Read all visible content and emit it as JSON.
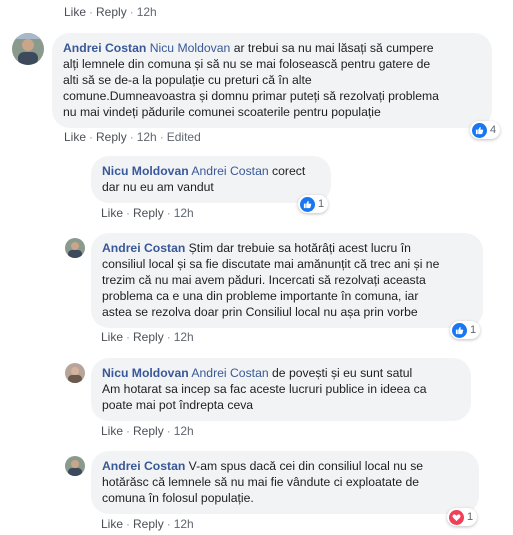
{
  "actions": {
    "like": "Like",
    "reply": "Reply",
    "sep": "·"
  },
  "top": {
    "time": "12h"
  },
  "comments": [
    {
      "author": "Andrei Costan",
      "mention": "Nicu Moldovan",
      "lines": [
        " ar trebui sa nu mai lăsați să cumpere",
        "alți lemnele din comuna și să nu se mai folosească pentru gatere de",
        "alti să se de-a la populație cu preturi că în alte",
        "comune.Dumneavoastra și domnu primar puteți să rezolvați problema",
        "nu mai vindeți pădurile comunei scoaterile pentru populație"
      ],
      "time": "12h",
      "edited": "Edited",
      "reactions": {
        "type": "like",
        "count": "4"
      }
    },
    {
      "author": "Nicu Moldovan",
      "mention": "Andrei Costan",
      "lines": [
        " corect",
        "dar nu eu am vandut"
      ],
      "time": "12h",
      "reactions": {
        "type": "like",
        "count": "1"
      }
    },
    {
      "author": "Andrei Costan",
      "mention": "",
      "lines": [
        " Știm dar trebuie sa hotărâți acest lucru în",
        "consiliul local și sa fie discutate mai amănunțit că trec ani și ne",
        "trezim că nu mai avem păduri. Incercati să rezolvați aceasta",
        "problema ca e una din probleme importante în comuna, iar",
        "astea se rezolva doar prin Consiliul local nu așa prin vorbe"
      ],
      "time": "12h",
      "reactions": {
        "type": "like",
        "count": "1"
      }
    },
    {
      "author": "Nicu Moldovan",
      "mention": "Andrei Costan",
      "lines": [
        " de povești și eu sunt satul",
        "Am hotarat sa incep sa fac aceste lucruri publice in ideea ca",
        "poate mai pot îndrepta ceva"
      ],
      "time": "12h"
    },
    {
      "author": "Andrei Costan",
      "mention": "",
      "lines": [
        " V-am spus dacă cei din consiliul local nu se",
        "hotărăsc că lemnele să nu mai fie vândute ci exploatate de",
        "comuna în folosul populație."
      ],
      "time": "12h",
      "reactions": {
        "type": "love",
        "count": "1"
      }
    }
  ],
  "colors": {
    "link": "#385898",
    "bubble": "#f2f3f5",
    "like": "#1877f2",
    "love": "#f33e58"
  }
}
